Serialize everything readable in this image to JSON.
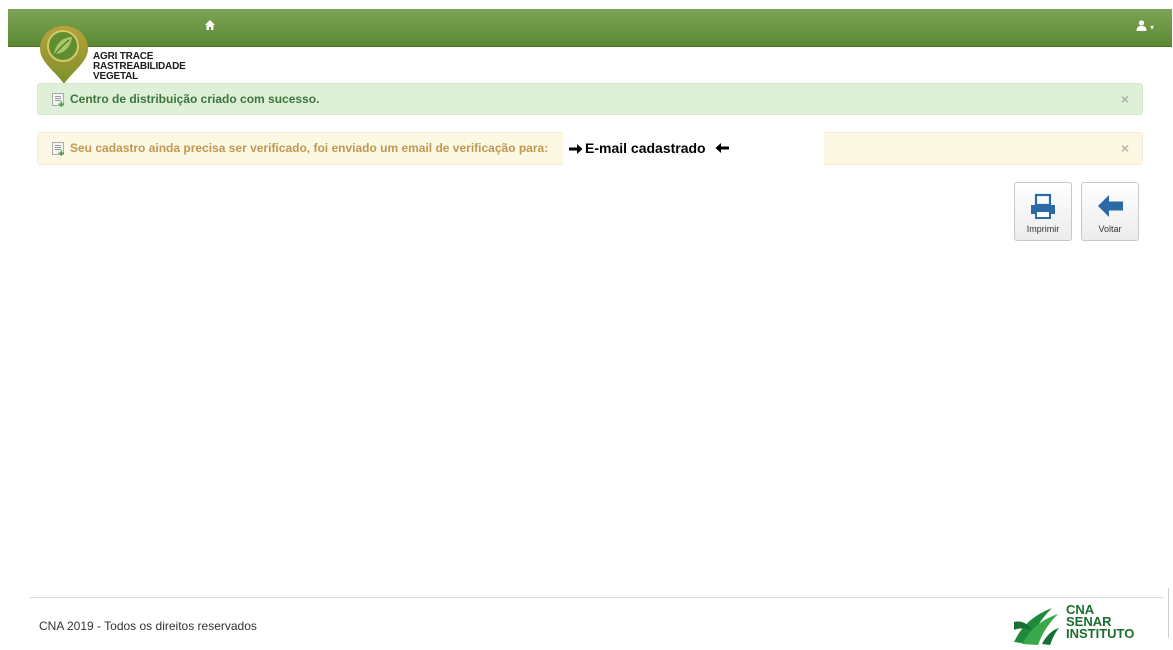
{
  "topbar": {
    "home_icon": "home-icon",
    "user_icon": "user-icon",
    "user_caret": "▾",
    "bar_color": "#6a9442"
  },
  "logo": {
    "lines": [
      "AGRI TRACE",
      "RASTREABILIDADE",
      "VEGETAL"
    ]
  },
  "alerts": {
    "success": {
      "message": "Centro de distribuição criado com sucesso.",
      "close": "×"
    },
    "warning": {
      "message": "Seu cadastro ainda precisa ser verificado, foi enviado um email de verificação para:",
      "email_label": "E-mail cadastrado",
      "close": "×"
    }
  },
  "toolbar": {
    "print_label": "Imprimir",
    "back_label": "Voltar"
  },
  "footer": {
    "copyright": "CNA 2019 - Todos os direitos reservados",
    "brand_lines": [
      "CNA",
      "SENAR",
      "INSTITUTO"
    ]
  }
}
